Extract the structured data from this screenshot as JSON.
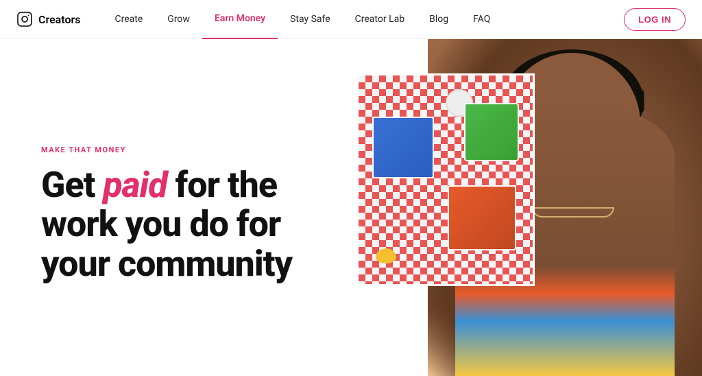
{
  "brand": {
    "name": "Creators",
    "logo_icon": "instagram"
  },
  "nav": {
    "links": [
      {
        "id": "create",
        "label": "Create",
        "active": false
      },
      {
        "id": "grow",
        "label": "Grow",
        "active": false
      },
      {
        "id": "earn-money",
        "label": "Earn Money",
        "active": true
      },
      {
        "id": "stay-safe",
        "label": "Stay Safe",
        "active": false
      },
      {
        "id": "creator-lab",
        "label": "Creator Lab",
        "active": false
      },
      {
        "id": "blog",
        "label": "Blog",
        "active": false
      },
      {
        "id": "faq",
        "label": "FAQ",
        "active": false
      }
    ],
    "login_label": "LOG IN"
  },
  "hero": {
    "tag": "MAKE THAT MONEY",
    "title_before": "Get ",
    "title_highlight": "paid",
    "title_after": " for the work you do for your community"
  },
  "colors": {
    "accent": "#e1306c",
    "active_nav": "#e1306c"
  }
}
